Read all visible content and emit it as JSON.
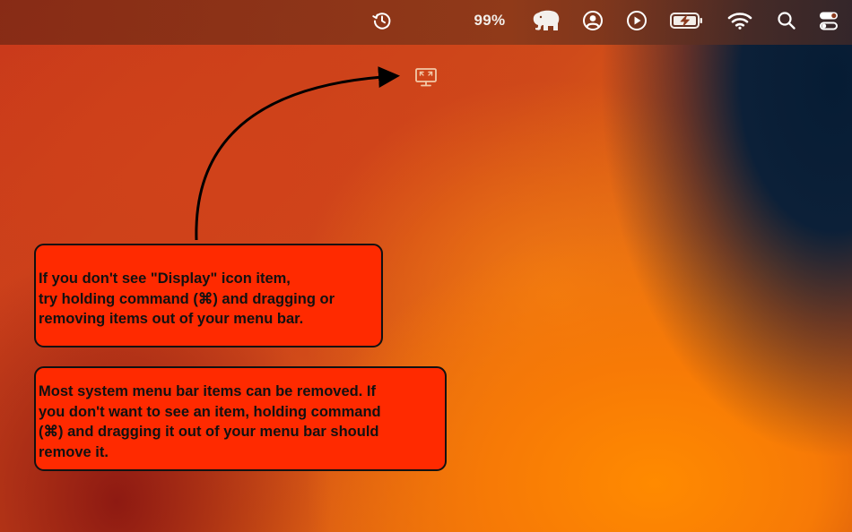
{
  "menubar": {
    "icons": [
      "time-machine-icon",
      "elephant-icon",
      "user-account-icon",
      "play-icon",
      "battery-charging-icon",
      "wifi-icon",
      "search-icon",
      "control-center-icon"
    ],
    "battery_percent": "99%"
  },
  "display_item": {
    "icon": "display-icon"
  },
  "callouts": {
    "first": "If you don't see \"Display\" icon item,\ntry holding command (⌘) and dragging or\nremoving items out of your menu bar.",
    "second": "Most system menu bar items can be removed. If\nyou don't want to see an item, holding command\n(⌘) and dragging it out of your menu bar should\nremove it."
  },
  "colors": {
    "callout_fill": "#ff2a00",
    "callout_border": "#111111",
    "arrow": "#000000",
    "menubar_icons": "#ffffff"
  }
}
